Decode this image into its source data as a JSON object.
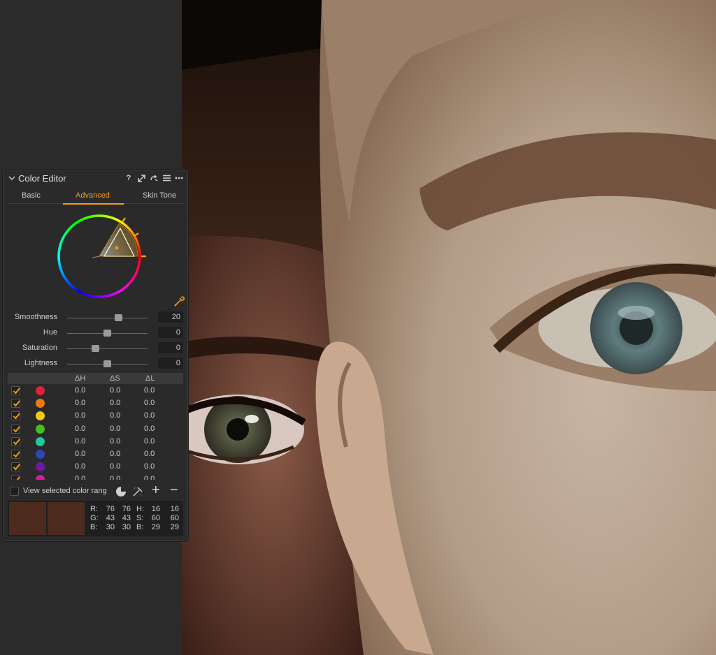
{
  "panel": {
    "title": "Color Editor",
    "tools": [
      "help-icon",
      "expand-icon",
      "reset-icon",
      "presets-menu-icon",
      "more-icon"
    ],
    "help_glyph": "?",
    "tabs": [
      "Basic",
      "Advanced",
      "Skin Tone"
    ],
    "active_tab": "Advanced"
  },
  "sliders": [
    {
      "label": "Smoothness",
      "value": "20",
      "level": 0.64
    },
    {
      "label": "Hue",
      "value": "0",
      "level": 0.5
    },
    {
      "label": "Saturation",
      "value": "0",
      "level": 0.35
    },
    {
      "label": "Lightness",
      "value": "0",
      "level": 0.5
    }
  ],
  "table": {
    "headers": [
      "ΔH",
      "ΔS",
      "ΔL"
    ],
    "rows": [
      {
        "color": "#e0203c",
        "checked": true,
        "dh": "0.0",
        "ds": "0.0",
        "dl": "0.0"
      },
      {
        "color": "#ee7716",
        "checked": true,
        "dh": "0.0",
        "ds": "0.0",
        "dl": "0.0"
      },
      {
        "color": "#f3cb17",
        "checked": true,
        "dh": "0.0",
        "ds": "0.0",
        "dl": "0.0"
      },
      {
        "color": "#42c021",
        "checked": true,
        "dh": "0.0",
        "ds": "0.0",
        "dl": "0.0"
      },
      {
        "color": "#22c99a",
        "checked": true,
        "dh": "0.0",
        "ds": "0.0",
        "dl": "0.0"
      },
      {
        "color": "#2f45b8",
        "checked": true,
        "dh": "0.0",
        "ds": "0.0",
        "dl": "0.0"
      },
      {
        "color": "#6a1aa8",
        "checked": true,
        "dh": "0.0",
        "ds": "0.0",
        "dl": "0.0"
      },
      {
        "color": "#d21e9c",
        "checked": true,
        "dh": "0.0",
        "ds": "0.0",
        "dl": "0.0"
      }
    ]
  },
  "footer": {
    "view_selected_label": "View selected color rang",
    "icons": [
      "color-range-icon",
      "picker-add-icon",
      "plus-icon",
      "minus-icon"
    ],
    "plus_glyph": "+",
    "minus_glyph": "−"
  },
  "readout": {
    "swatch_color": "#4c2b1e",
    "rgb": {
      "labels": [
        "R:",
        "G:",
        "B:"
      ],
      "a": [
        "76",
        "43",
        "30"
      ],
      "b": [
        "76",
        "43",
        "30"
      ]
    },
    "hsb": {
      "labels": [
        "H:",
        "S:",
        "B:"
      ],
      "a": [
        "16",
        "60",
        "29"
      ],
      "b": [
        "16",
        "60",
        "29"
      ]
    }
  },
  "colors": {
    "accent": "#f29b21",
    "panel_bg": "#2a2a2a",
    "app_bg": "#2b2b2b"
  }
}
